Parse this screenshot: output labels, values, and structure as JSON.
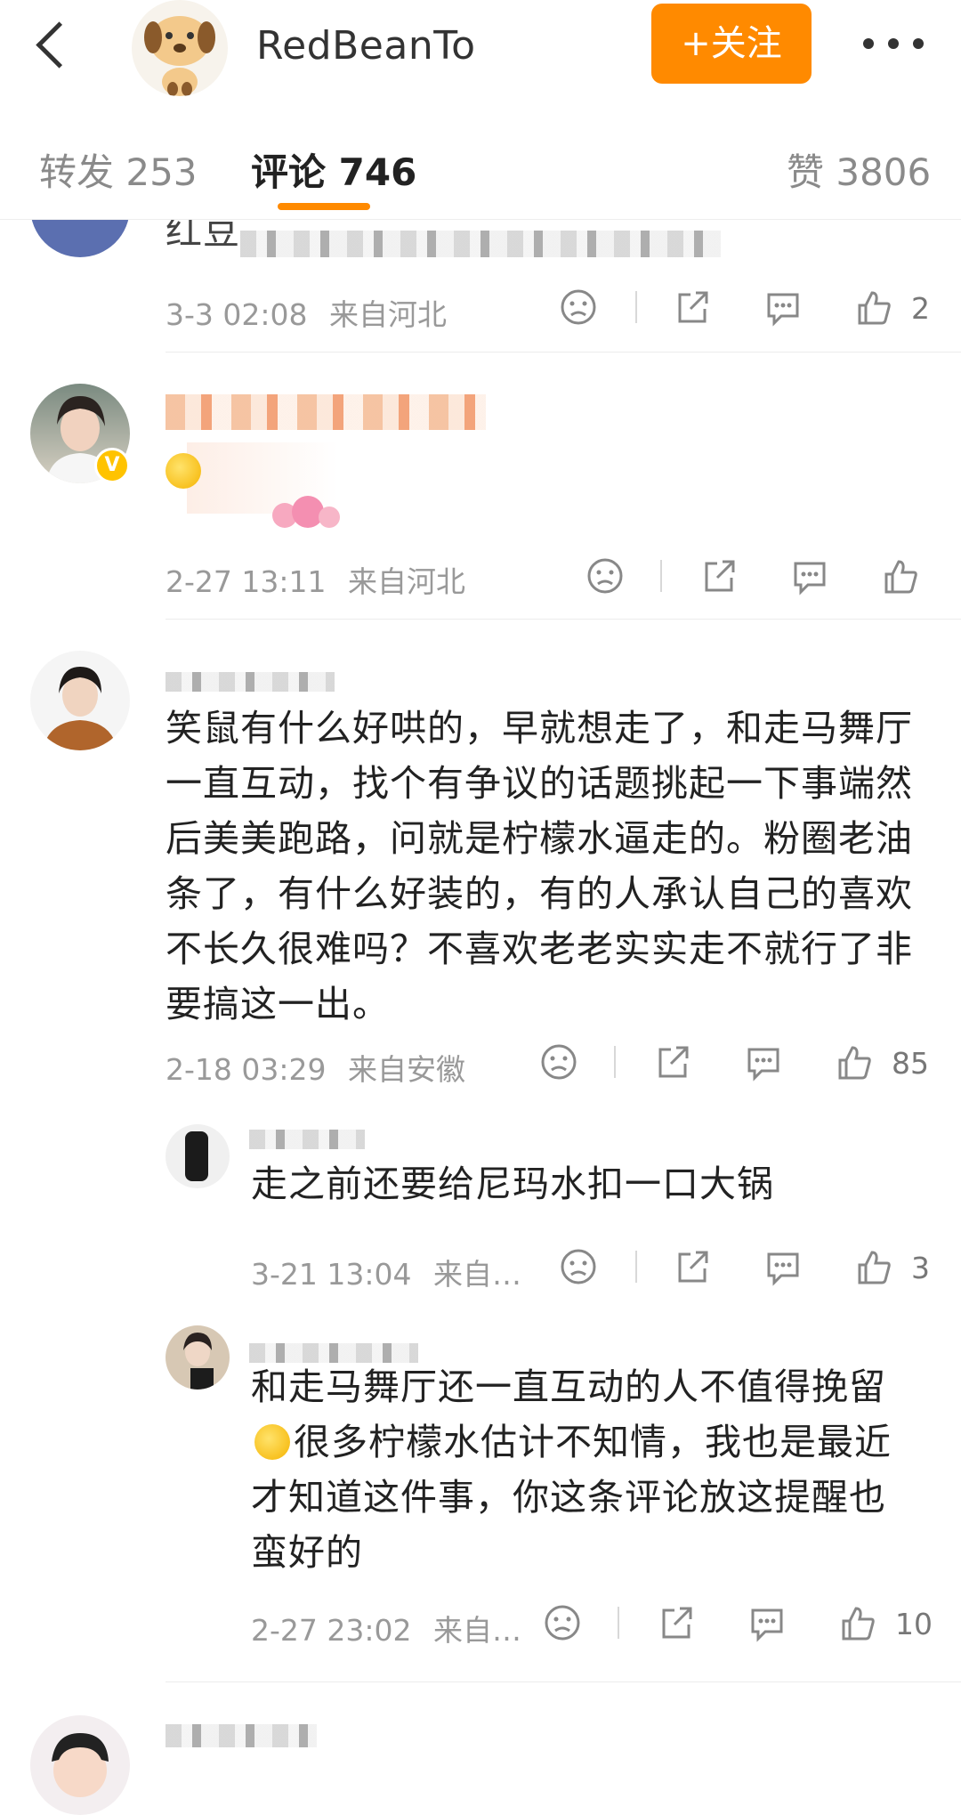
{
  "header": {
    "app_name": "RedBeanTo",
    "follow_label": "+关注"
  },
  "tabs": {
    "repost": "转发 253",
    "comments": "评论 746",
    "likes": "赞 3806"
  },
  "comments": [
    {
      "text_partial": "红豆",
      "time": "3-3 02:08",
      "location": "来自河北",
      "likes": "2"
    },
    {
      "time": "2-27 13:11",
      "location": "来自河北",
      "likes": ""
    },
    {
      "text": "笑鼠有什么好哄的，早就想走了，和走马舞厅一直互动，找个有争议的话题挑起一下事端然后美美跑路，问就是柠檬水逼走的。粉圈老油条了，有什么好装的，有的人承认自己的喜欢不长久很难吗？不喜欢老老实实走不就行了非要搞这一出。",
      "time": "2-18 03:29",
      "location": "来自安徽",
      "likes": "85",
      "replies": [
        {
          "text": "走之前还要给尼玛水扣一口大锅",
          "time": "3-21 13:04",
          "location": "来自…",
          "likes": "3"
        },
        {
          "text_a": "和走马舞厅还一直互动的人不值得挽留",
          "text_b": "很多柠檬水估计不知情，我也是最近才知道这件事，你这条评论放这提醒也蛮好的",
          "time": "2-27 23:02",
          "location": "来自…",
          "likes": "10"
        }
      ]
    }
  ]
}
